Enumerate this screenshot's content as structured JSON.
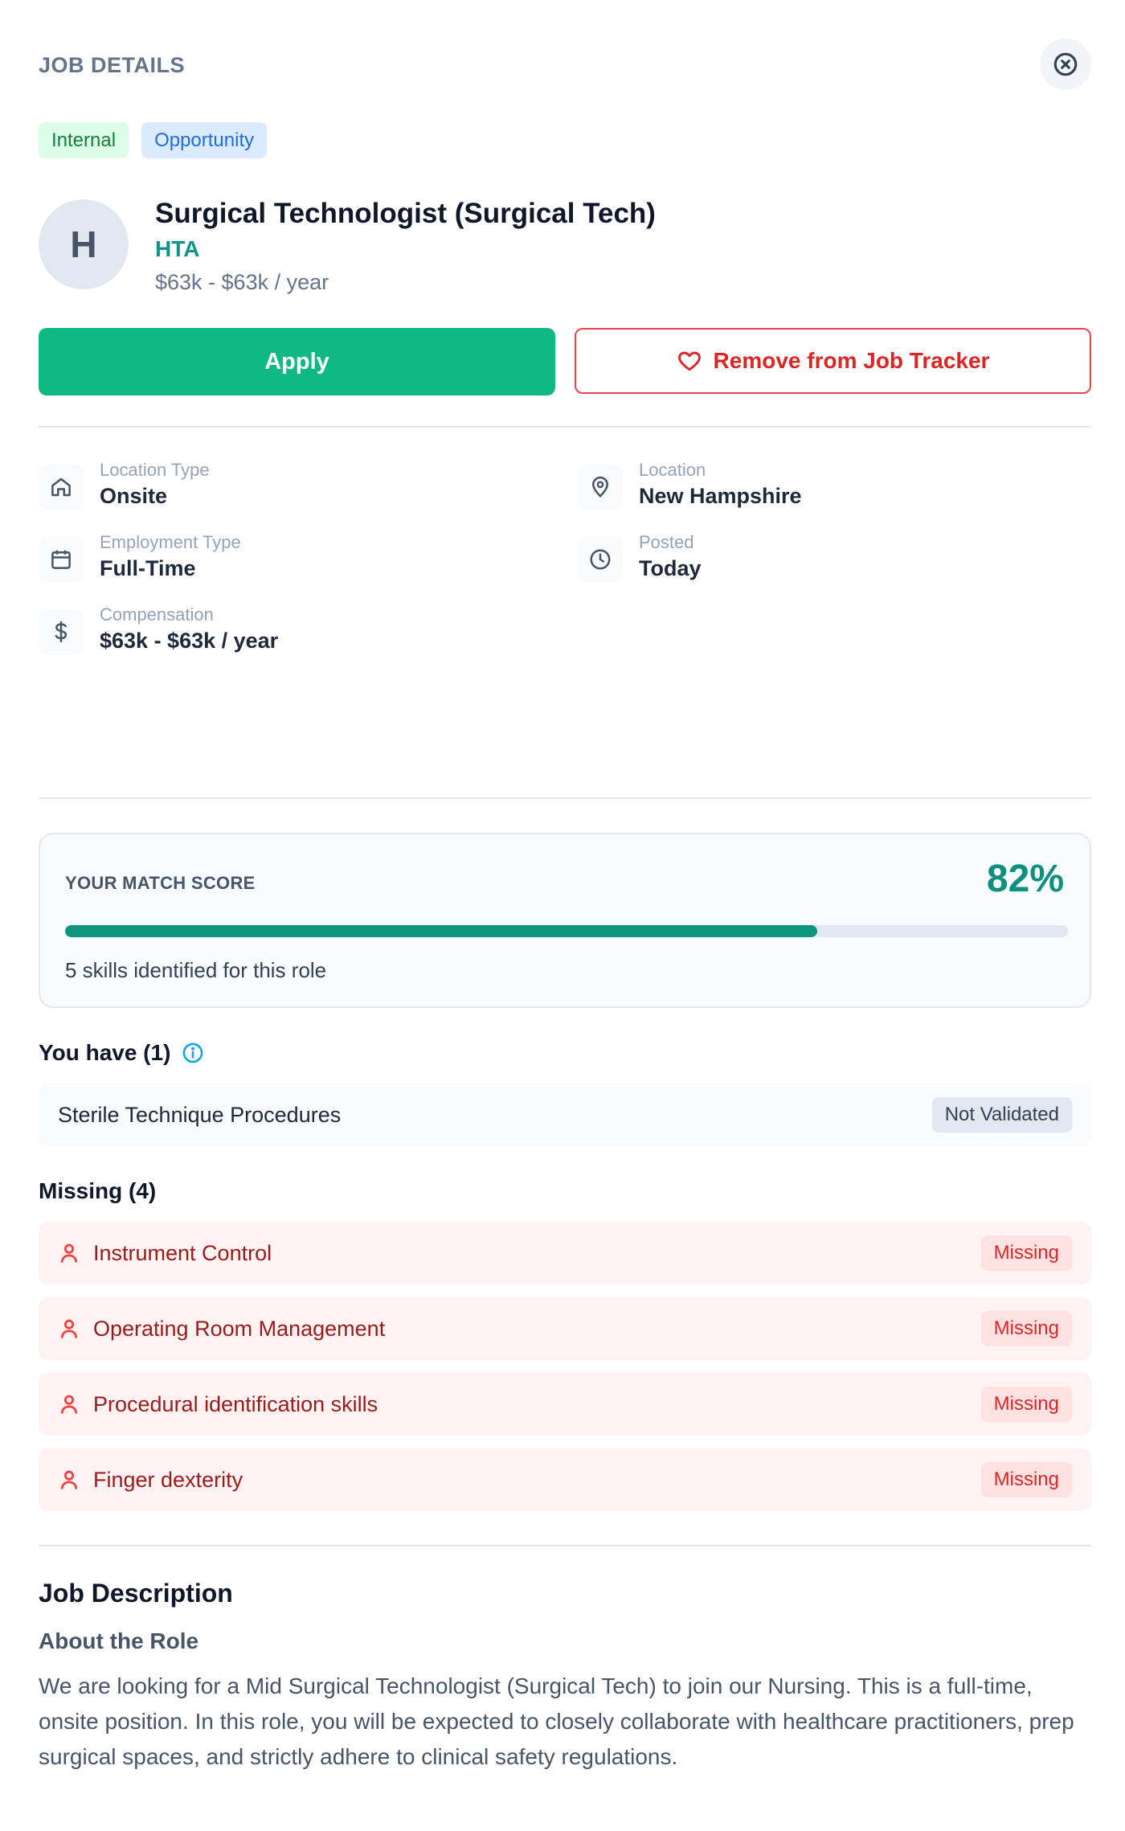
{
  "header": {
    "title": "JOB DETAILS",
    "close_icon": "close-circle-icon"
  },
  "tags": [
    {
      "label": "Internal"
    },
    {
      "label": "Opportunity"
    }
  ],
  "job": {
    "avatar_letter": "H",
    "title": "Surgical Technologist (Surgical Tech)",
    "company": "HTA",
    "salary": "$63k - $63k / year"
  },
  "actions": {
    "apply_label": "Apply",
    "remove_label": "Remove from Job Tracker",
    "remove_icon": "heart-icon"
  },
  "details": [
    {
      "icon": "home-icon",
      "label": "Location Type",
      "value": "Onsite"
    },
    {
      "icon": "map-pin-icon",
      "label": "Location",
      "value": "New Hampshire"
    },
    {
      "icon": "calendar-icon",
      "label": "Employment Type",
      "value": "Full-Time"
    },
    {
      "icon": "clock-icon",
      "label": "Posted",
      "value": "Today"
    },
    {
      "icon": "dollar-icon",
      "label": "Compensation",
      "value": "$63k - $63k / year"
    }
  ],
  "match": {
    "label": "YOUR MATCH SCORE",
    "score_text": "82%",
    "score_fraction": 0.75,
    "subtitle": "5 skills identified for this role"
  },
  "you_have": {
    "heading": "You have (1)",
    "info_icon": "info-icon",
    "items": [
      {
        "name": "Sterile Technique Procedures",
        "status": "Not Validated"
      }
    ]
  },
  "missing": {
    "heading": "Missing (4)",
    "item_icon": "user-icon",
    "items": [
      {
        "name": "Instrument Control",
        "status": "Missing"
      },
      {
        "name": "Operating Room Management",
        "status": "Missing"
      },
      {
        "name": "Procedural identification skills",
        "status": "Missing"
      },
      {
        "name": "Finger dexterity",
        "status": "Missing"
      }
    ]
  },
  "description": {
    "title": "Job Description",
    "subtitle": "About the Role",
    "body": "We are looking for a Mid Surgical Technologist (Surgical Tech) to join our Nursing. This is a full-time, onsite position. In this role, you will be expected to closely collaborate with healthcare practitioners, prep surgical spaces, and strictly adhere to clinical safety regulations."
  },
  "colors": {
    "accent_green": "#10b981",
    "teal": "#0d9488",
    "danger": "#dc2626"
  }
}
